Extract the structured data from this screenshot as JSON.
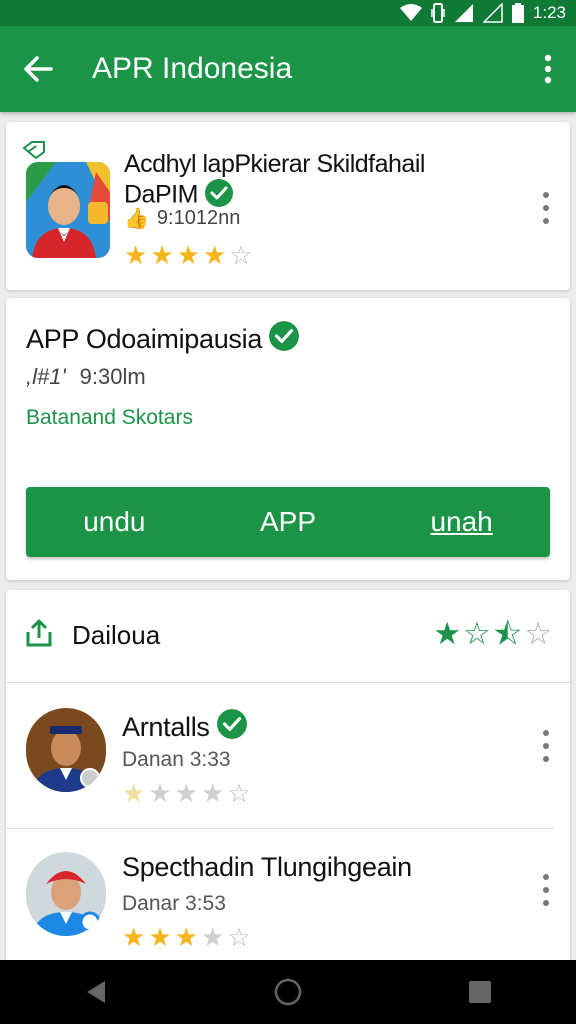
{
  "status": {
    "time": "1:23",
    "icons": [
      "wifi-icon",
      "vibrate-icon",
      "signal-icon",
      "signal-empty-icon",
      "battery-icon"
    ]
  },
  "app_bar": {
    "title": "APR Indonesia",
    "back_icon": "arrow-back-icon",
    "menu_icon": "more-vert-icon"
  },
  "card1": {
    "title": "Acdhyl lapPkierar Skildfahail DaPIM",
    "meta": "9:1012nn",
    "rating": 4,
    "rating_max": 5
  },
  "card2": {
    "title": "APP Odoaimipausia",
    "meta_glyph": ",l#1'",
    "meta": "9:30lm",
    "link": "Batanand Skotars",
    "actions": [
      "undu",
      "APP",
      "unah"
    ]
  },
  "card3": {
    "header": "Dailoua",
    "header_rating_glyphs": [
      "★",
      "☆",
      "⯪",
      "☆"
    ],
    "reviews": [
      {
        "name": "Arntalls",
        "date": "Danan 3:33",
        "rating": 1,
        "verified": true
      },
      {
        "name": "Specthadin Tlungihgeain",
        "date": "Danar 3:53",
        "rating": 3,
        "verified": false
      }
    ]
  },
  "colors": {
    "primary": "#1b9447",
    "primary_dark": "#0f7a36",
    "star": "#f5b51b",
    "verified": "#1b9447"
  }
}
